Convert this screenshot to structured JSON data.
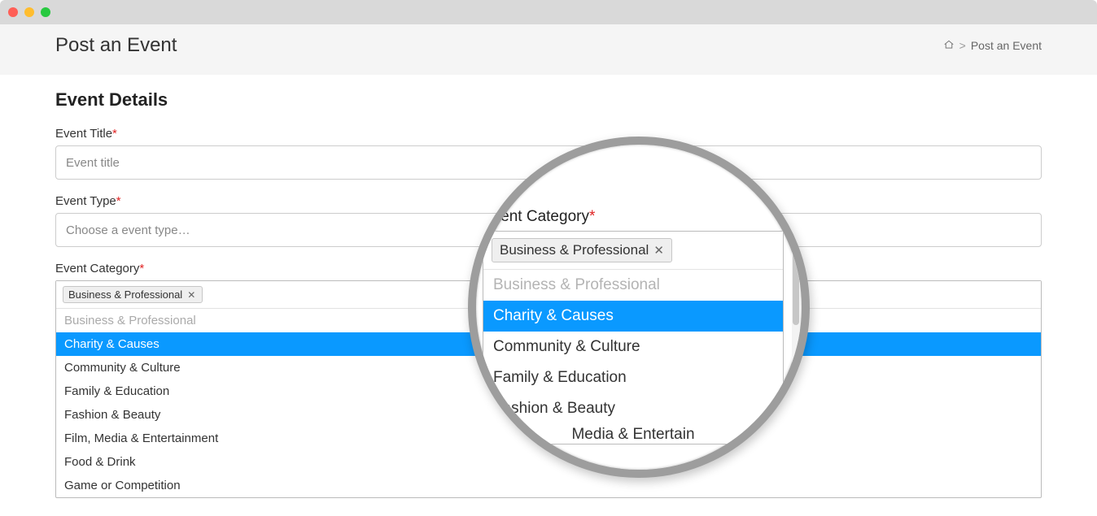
{
  "page": {
    "title": "Post an Event",
    "breadcrumb_current": "Post an Event"
  },
  "section": {
    "title": "Event Details"
  },
  "fields": {
    "title": {
      "label": "Event Title",
      "placeholder": "Event title",
      "value": ""
    },
    "type": {
      "label": "Event Type",
      "placeholder": "Choose a event type…",
      "value": ""
    },
    "category": {
      "label": "Event Category",
      "selected_tag": "Business & Professional",
      "options": [
        {
          "label": "Business & Professional",
          "state": "disabled"
        },
        {
          "label": "Charity & Causes",
          "state": "highlight"
        },
        {
          "label": "Community & Culture",
          "state": "normal"
        },
        {
          "label": "Family & Education",
          "state": "normal"
        },
        {
          "label": "Fashion & Beauty",
          "state": "normal"
        },
        {
          "label": "Film, Media & Entertainment",
          "state": "normal"
        },
        {
          "label": "Food & Drink",
          "state": "normal"
        },
        {
          "label": "Game or Competition",
          "state": "normal"
        }
      ]
    }
  },
  "zoom": {
    "label": "Event Category",
    "tag": "Business & Professional",
    "options": [
      {
        "label": "Business & Professional",
        "state": "disabled"
      },
      {
        "label": "Charity & Causes",
        "state": "highlight"
      },
      {
        "label": "Community & Culture",
        "state": "normal"
      },
      {
        "label": "Family & Education",
        "state": "normal"
      },
      {
        "label": "Fashion & Beauty",
        "state": "normal"
      }
    ],
    "partial_last": "Media & Entertain"
  }
}
